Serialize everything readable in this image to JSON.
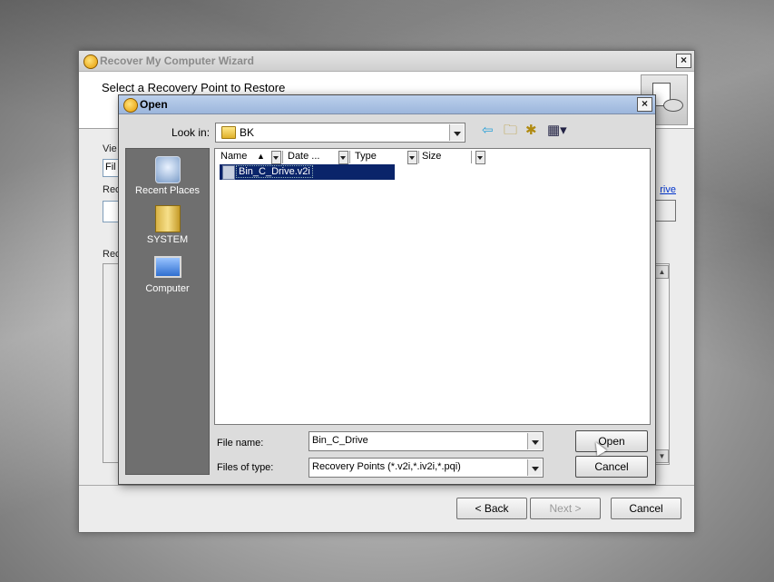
{
  "wizard": {
    "title": "Recover My Computer Wizard",
    "header": "Select a Recovery Point to Restore",
    "frag_view": "Vie",
    "frag_file": "Fil",
    "frag_rec1": "Rec",
    "frag_rec2": "Rec",
    "link_frag": "rive",
    "back_button": "< Back",
    "next_button": "Next >",
    "cancel_button": "Cancel"
  },
  "dialog": {
    "title": "Open",
    "look_in_label": "Look in:",
    "look_in_value": "BK",
    "places": [
      {
        "label": "Recent Places",
        "icon": "recent-places-icon"
      },
      {
        "label": "SYSTEM",
        "icon": "folder-icon"
      },
      {
        "label": "Computer",
        "icon": "computer-icon"
      }
    ],
    "columns": [
      "Name",
      "Date ...",
      "Type",
      "Size"
    ],
    "files": [
      {
        "name": "Bin_C_Drive.v2i",
        "selected": true
      }
    ],
    "file_name_label": "File name:",
    "file_name_value": "Bin_C_Drive",
    "file_type_label": "Files of type:",
    "file_type_value": "Recovery Points (*.v2i,*.iv2i,*.pqi)",
    "open_button": "Open",
    "cancel_button": "Cancel"
  },
  "colors": {
    "selection": "#0a246a",
    "places_bg": "#6f6f6f",
    "title_active": "#9cb6dc"
  }
}
